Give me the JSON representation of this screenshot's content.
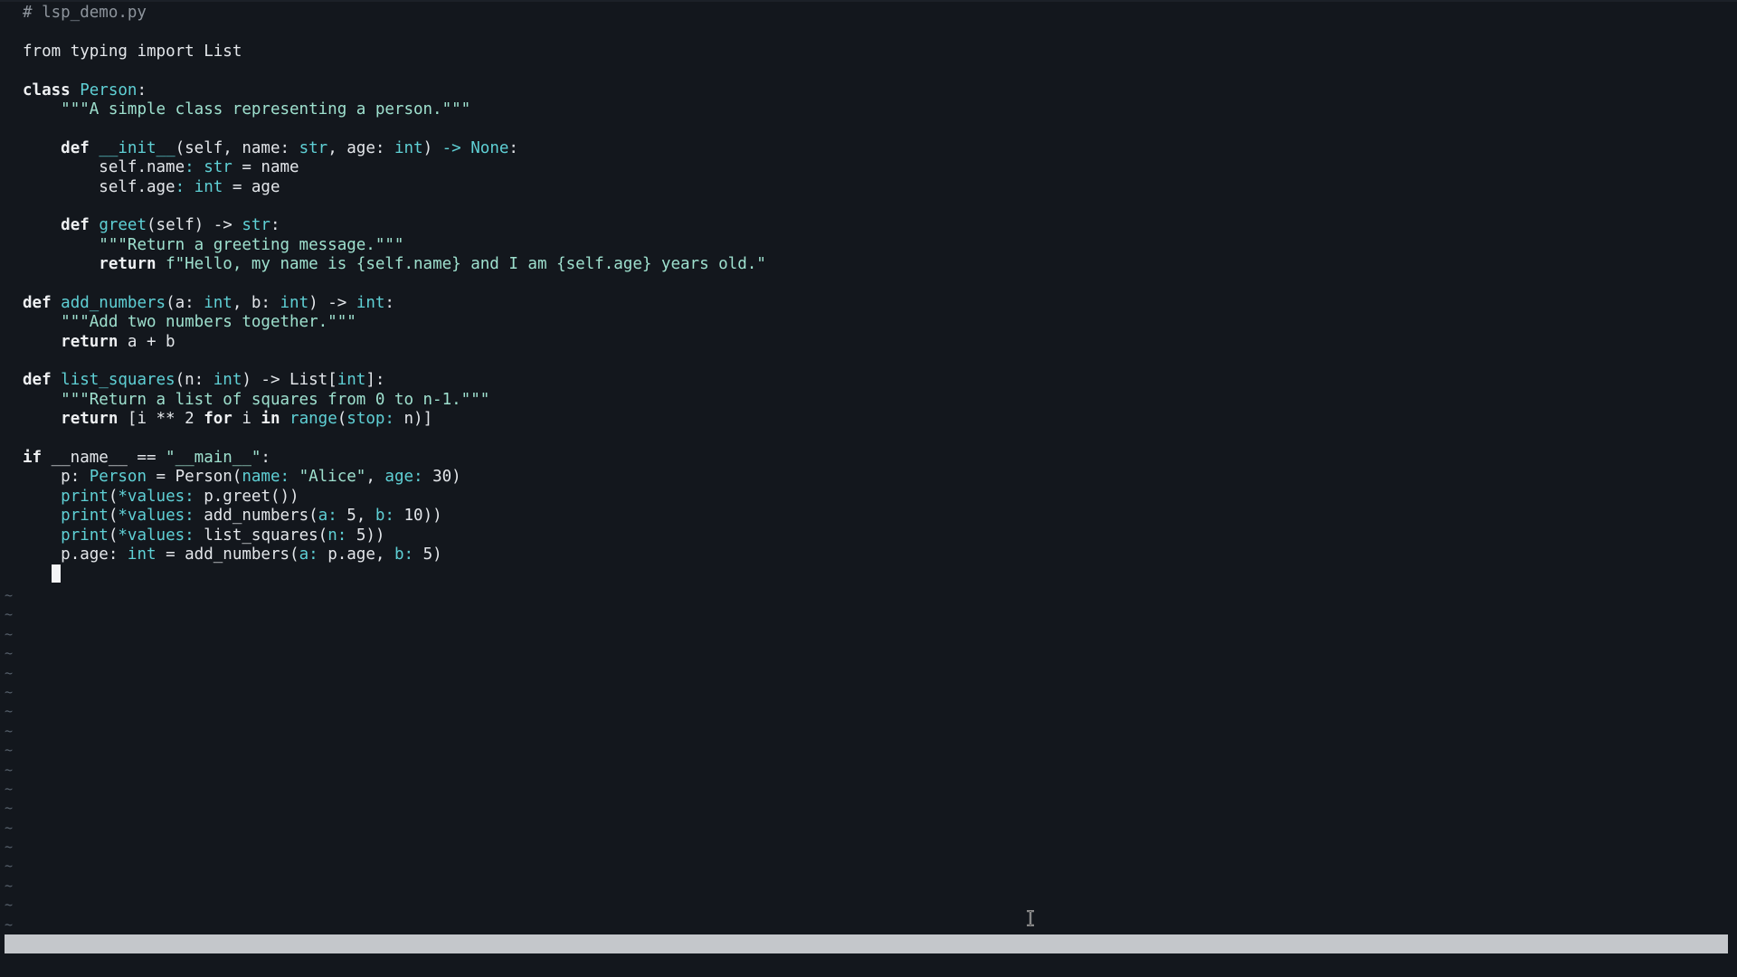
{
  "editor": {
    "lines": [
      {
        "comment": "# lsp_demo.py"
      },
      {},
      {
        "kw_from": "from",
        "mod": "typing",
        "kw_import": "import",
        "name": "List"
      },
      {},
      {
        "kw": "class",
        "cls": "Person",
        "punc": ":"
      },
      {
        "indent": "    ",
        "doc": "\"\"\"A simple class representing a person.\"\"\""
      },
      {},
      {
        "indent": "    ",
        "kw": "def",
        "fn": "__init__",
        "a": "(self, name: ",
        "t1": "str",
        "b": ", age: ",
        "t2": "int",
        "c": ") ",
        "arrow": "->",
        "d": " ",
        "t3": "None",
        "e": ":"
      },
      {
        "indent": "        ",
        "a": "self.name",
        "b": ": ",
        "t1": "str",
        "c": " = name"
      },
      {
        "indent": "        ",
        "a": "self.age",
        "b": ": ",
        "t1": "int",
        "c": " = age"
      },
      {},
      {
        "indent": "    ",
        "kw": "def",
        "fn": "greet",
        "a": "(self) -> ",
        "t1": "str",
        "e": ":"
      },
      {
        "indent": "        ",
        "doc": "\"\"\"Return a greeting message.\"\"\""
      },
      {
        "indent": "        ",
        "kw": "return",
        "s": "f\"Hello, my name is {self.name} and I am {self.age} years old.\""
      },
      {},
      {
        "kw": "def",
        "fn": "add_numbers",
        "a": "(a: ",
        "t1": "int",
        "b": ", b: ",
        "t2": "int",
        "c": ") -> ",
        "t3": "int",
        "e": ":"
      },
      {
        "indent": "    ",
        "doc": "\"\"\"Add two numbers together.\"\"\""
      },
      {
        "indent": "    ",
        "kw": "return",
        "rest": " a + b"
      },
      {},
      {
        "kw": "def",
        "fn": "list_squares",
        "a": "(n: ",
        "t1": "int",
        "b": ") -> List[",
        "t2": "int",
        "c": "]:"
      },
      {
        "indent": "    ",
        "doc": "\"\"\"Return a list of squares from 0 to n-1.\"\"\""
      },
      {
        "indent": "    ",
        "kw": "return",
        "a": " [i ** 2 ",
        "kw2": "for",
        "b": " i ",
        "kw3": "in",
        "c": " ",
        "fn": "range",
        "d": "(",
        "p1": "stop:",
        "e": " n)]"
      },
      {},
      {
        "kw": "if",
        "a": " __name__ == ",
        "s": "\"__main__\"",
        "b": ":"
      },
      {
        "indent": "    ",
        "a": "p: ",
        "t1": "Person",
        "b": " = Person(",
        "p1": "name:",
        "c": " ",
        "s": "\"Alice\"",
        "d": ", ",
        "p2": "age:",
        "e": " 30)"
      },
      {
        "indent": "    ",
        "fn": "print",
        "a": "(",
        "p1": "*values:",
        "b": " p.greet())"
      },
      {
        "indent": "    ",
        "fn": "print",
        "a": "(",
        "p1": "*values:",
        "b": " add_numbers(",
        "p2": "a:",
        "c": " 5, ",
        "p3": "b:",
        "d": " 10))"
      },
      {
        "indent": "    ",
        "fn": "print",
        "a": "(",
        "p1": "*values:",
        "b": " list_squares(",
        "p2": "n:",
        "c": " 5))"
      },
      {
        "indent": "    ",
        "a": "p.age: ",
        "t1": "int",
        "b": " = add_numbers(",
        "p1": "a:",
        "c": " p.age, ",
        "p2": "b:",
        "d": " 5)"
      }
    ],
    "cursor_indent": "   ",
    "tilde": "~",
    "tilde_count": 18
  },
  "colors": {
    "background": "#13171d",
    "text": "#e3e6ea",
    "keyword": "#eef0f2",
    "function": "#5fd0d5",
    "string": "#9ee0ce",
    "comment": "#8d949c",
    "status_bar": "#c4c7cb"
  },
  "icons": {
    "mouse_pointer": "ibeam-cursor-icon"
  }
}
